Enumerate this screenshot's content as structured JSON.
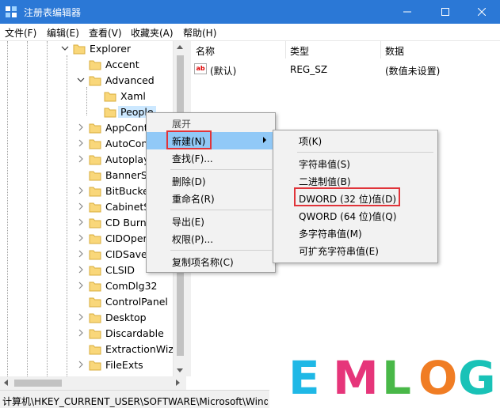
{
  "window": {
    "title": "注册表编辑器",
    "title_bar_color": "#2b78d6"
  },
  "menu": {
    "items": [
      "文件(F)",
      "编辑(E)",
      "查看(V)",
      "收藏夹(A)",
      "帮助(H)"
    ]
  },
  "tree": {
    "items": [
      {
        "label": "Explorer"
      },
      {
        "label": "Accent"
      },
      {
        "label": "Advanced"
      },
      {
        "label": "Xaml"
      },
      {
        "label": "People"
      },
      {
        "label": "AppCont"
      },
      {
        "label": "AutoCon"
      },
      {
        "label": "Autoplay"
      },
      {
        "label": "BannerSt"
      },
      {
        "label": "BitBucke"
      },
      {
        "label": "CabinetS"
      },
      {
        "label": "CD Burni"
      },
      {
        "label": "CIDOper"
      },
      {
        "label": "CIDSave"
      },
      {
        "label": "CLSID"
      },
      {
        "label": "ComDlg32"
      },
      {
        "label": "ControlPanel"
      },
      {
        "label": "Desktop"
      },
      {
        "label": "Discardable"
      },
      {
        "label": "ExtractionWiza"
      },
      {
        "label": "FileExts"
      }
    ]
  },
  "values": {
    "columns": [
      "名称",
      "类型",
      "数据"
    ],
    "rows": [
      {
        "name": "(默认)",
        "type": "REG_SZ",
        "data": "(数值未设置)",
        "icon": "ab"
      }
    ]
  },
  "context_menu": {
    "header": "展开",
    "items": [
      "新建(N)",
      "查找(F)...",
      "删除(D)",
      "重命名(R)",
      "导出(E)",
      "权限(P)...",
      "复制项名称(C)"
    ]
  },
  "submenu": {
    "items": [
      "项(K)",
      "字符串值(S)",
      "二进制值(B)",
      "DWORD (32 位)值(D)",
      "QWORD (64 位)值(Q)",
      "多字符串值(M)",
      "可扩充字符串值(E)"
    ]
  },
  "status": {
    "path": "计算机\\HKEY_CURRENT_USER\\SOFTWARE\\Microsoft\\Windows\\CurrentVersion\\Explorer\\Advanced\\People"
  },
  "watermark": {
    "letters": [
      "E",
      "M",
      "L",
      "O",
      "G"
    ],
    "colors": [
      "#1fb8e6",
      "#e6357a",
      "#49b848",
      "#f07d24",
      "#19c2b7"
    ]
  },
  "highlight_color": "#e0343a"
}
